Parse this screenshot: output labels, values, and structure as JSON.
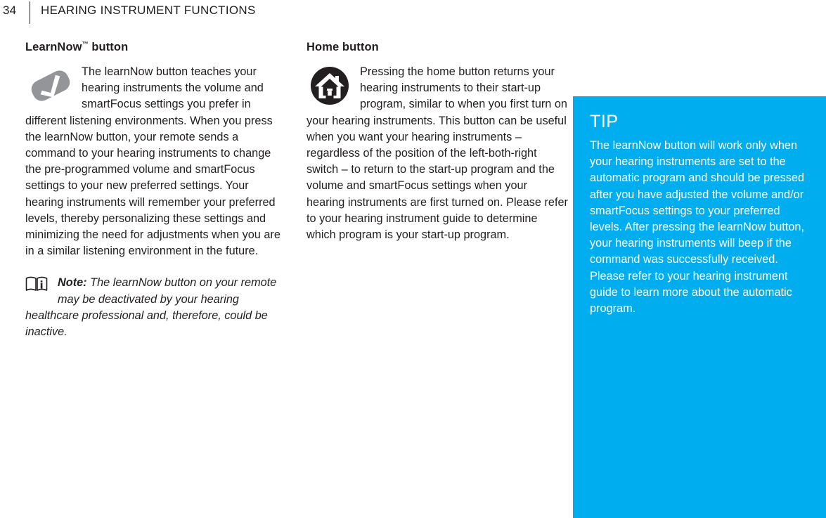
{
  "header": {
    "page_number": "34",
    "title": "HEARING INSTRUMENT FUNCTIONS",
    "divider": "vertical-rule"
  },
  "colors": {
    "text": "#231F20",
    "tip_background": "#00AEEF",
    "tip_text": "#FFFFFF",
    "learnnow_icon": "#939598",
    "home_icon": "#231F20"
  },
  "left_column": {
    "heading": "LearnNow",
    "heading_superscript": "™",
    "heading_suffix": " button",
    "icon_name": "learnnow-check-button-icon",
    "body": "The learnNow button teaches your hearing instruments the volume and smartFocus settings you prefer in different listening environments. When you press the learnNow button, your remote sends a command to your hearing instruments to change the pre-programmed volume and smartFocus settings to your new preferred settings. Your hearing instruments will remember your preferred levels, thereby personalizing these settings and minimizing the need for adjustments when you are in a similar listening environment in the future.",
    "note": {
      "icon_name": "instruction-manual-icon",
      "label": "Note:",
      "text": " The learnNow button on your remote may be deactivated by your hearing healthcare professional and, therefore, could be inactive."
    }
  },
  "right_column": {
    "heading": "Home button",
    "icon_name": "home-button-icon",
    "body": "Pressing the home button returns your hearing instruments to their start-up program, similar to when you first turn on your hearing instruments. This button can be useful when you want your hearing instruments – regardless of the position of the left-both-right switch – to return to the start-up program and the volume and smartFocus settings when your hearing instruments are first turned on. Please refer to your hearing instrument guide to determine which program is your start-up program."
  },
  "tip_panel": {
    "heading": "TIP",
    "body": "The learnNow button will work only when your hearing instruments are set to the automatic program and should be pressed after you have adjusted the volume and/or smartFocus settings to your preferred levels. After pressing the learnNow button, your hearing instruments will beep if the command was successfully received. Please refer to your hearing instrument guide to learn more about the automatic program."
  }
}
